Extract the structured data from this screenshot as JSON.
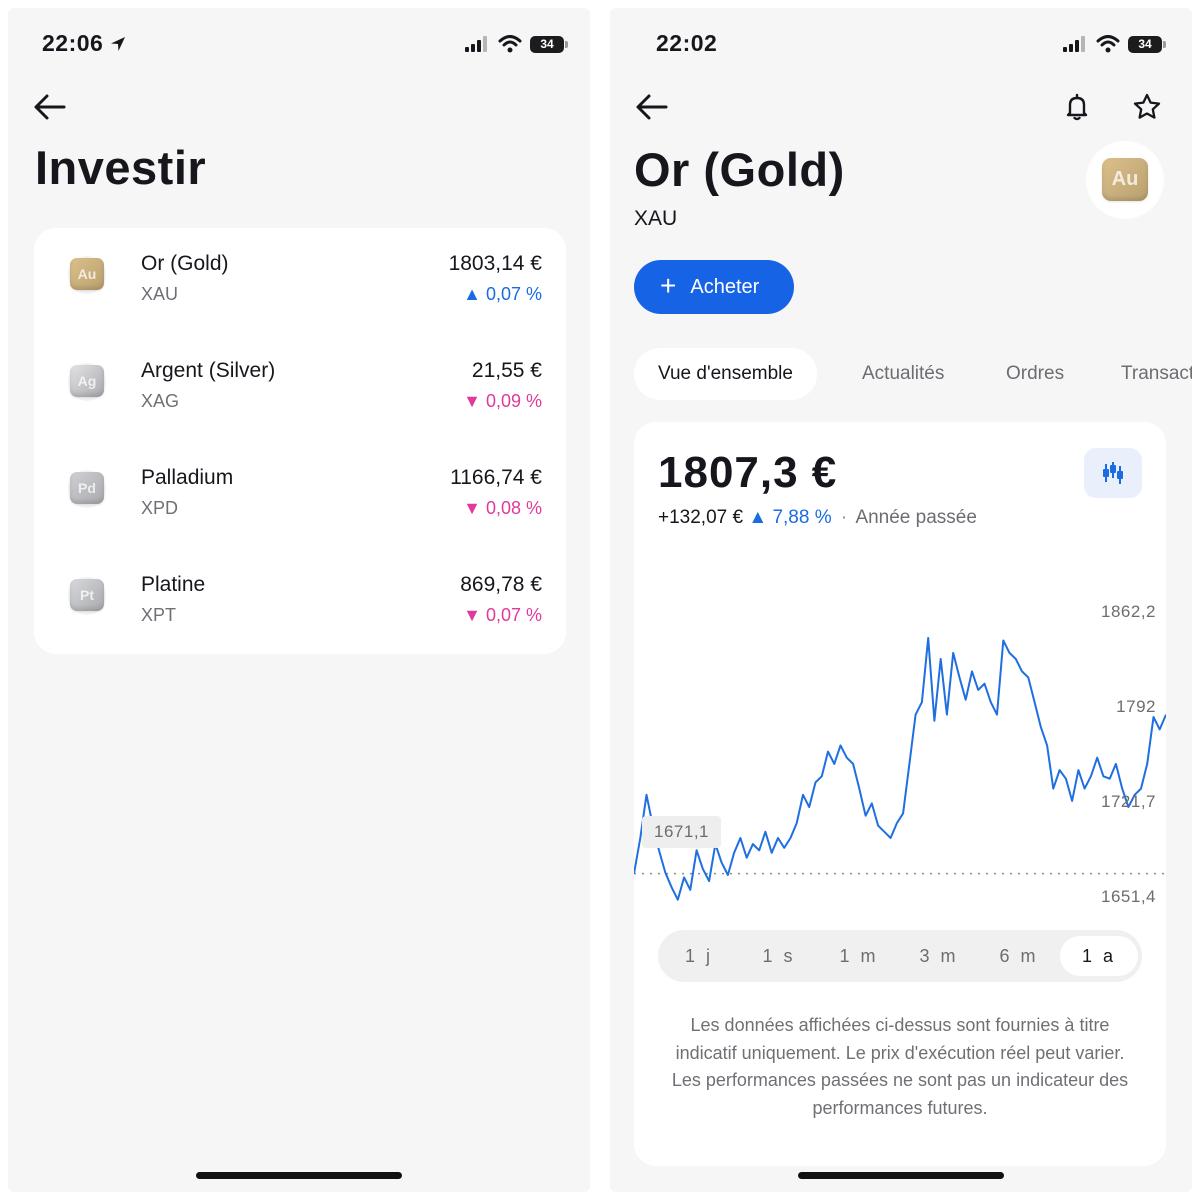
{
  "left_screen": {
    "status": {
      "time": "22:06",
      "battery": "34"
    },
    "title": "Investir",
    "assets": [
      {
        "name": "Or (Gold)",
        "symbol": "XAU",
        "logo": "Au",
        "price": "1803,14 €",
        "change": "0,07 %",
        "direction": "up",
        "cube_color": "#dcc08c"
      },
      {
        "name": "Argent (Silver)",
        "symbol": "XAG",
        "logo": "Ag",
        "price": "21,55 €",
        "change": "0,09 %",
        "direction": "down",
        "cube_color": "#e3e3e5"
      },
      {
        "name": "Palladium",
        "symbol": "XPD",
        "logo": "Pd",
        "price": "1166,74 €",
        "change": "0,08 %",
        "direction": "down",
        "cube_color": "#cfd0d3"
      },
      {
        "name": "Platine",
        "symbol": "XPT",
        "logo": "Pt",
        "price": "869,78 €",
        "change": "0,07 %",
        "direction": "down",
        "cube_color": "#d8d9dc"
      }
    ]
  },
  "right_screen": {
    "status": {
      "time": "22:02",
      "battery": "34"
    },
    "title": "Or (Gold)",
    "symbol": "XAU",
    "logo": "Au",
    "buy_label": "Acheter",
    "tabs": [
      "Vue d'ensemble",
      "Actualités",
      "Ordres",
      "Transactions"
    ],
    "active_tab": "Vue d'ensemble",
    "price": "1807,3 €",
    "perf_abs": "+132,07 €",
    "perf_pct": "7,88 %",
    "perf_period": "Année passée",
    "y_labels": [
      "1862,2",
      "1792",
      "1721,7",
      "1651,4"
    ],
    "start_label": "1671,1",
    "ranges": [
      "1 j",
      "1 s",
      "1 m",
      "3 m",
      "6 m",
      "1 a"
    ],
    "active_range": "1 a",
    "disclaimer": "Les données affichées ci-dessus sont fournies à titre indicatif uniquement. Le prix d'exécution réel peut varier. Les performances passées ne sont pas un indicateur des performances futures."
  },
  "colors": {
    "accent": "#1763e6",
    "up": "#1a6ce0",
    "down": "#e03a9a",
    "line": "#1f6fe0"
  },
  "chart_data": {
    "type": "line",
    "title": "",
    "xlabel": "",
    "ylabel": "",
    "ylim": [
      1640,
      1875
    ],
    "y_ticks": [
      1862.2,
      1792,
      1721.7,
      1651.4
    ],
    "baseline": 1671.1,
    "series": [
      {
        "values": [
          1671.1,
          1700,
          1735,
          1710,
          1690,
          1672,
          1660,
          1650,
          1668,
          1658,
          1690,
          1675,
          1665,
          1695,
          1680,
          1670,
          1688,
          1700,
          1684,
          1695,
          1690,
          1705,
          1688,
          1700,
          1692,
          1700,
          1712,
          1735,
          1725,
          1745,
          1750,
          1770,
          1760,
          1775,
          1765,
          1760,
          1740,
          1718,
          1728,
          1710,
          1705,
          1700,
          1712,
          1720,
          1760,
          1800,
          1810,
          1862,
          1795,
          1845,
          1800,
          1850,
          1830,
          1812,
          1835,
          1820,
          1825,
          1810,
          1800,
          1860,
          1850,
          1845,
          1835,
          1830,
          1810,
          1790,
          1775,
          1740,
          1755,
          1748,
          1730,
          1755,
          1740,
          1750,
          1765,
          1750,
          1748,
          1760,
          1740,
          1725,
          1735,
          1740,
          1760,
          1798,
          1788,
          1800
        ]
      }
    ]
  }
}
